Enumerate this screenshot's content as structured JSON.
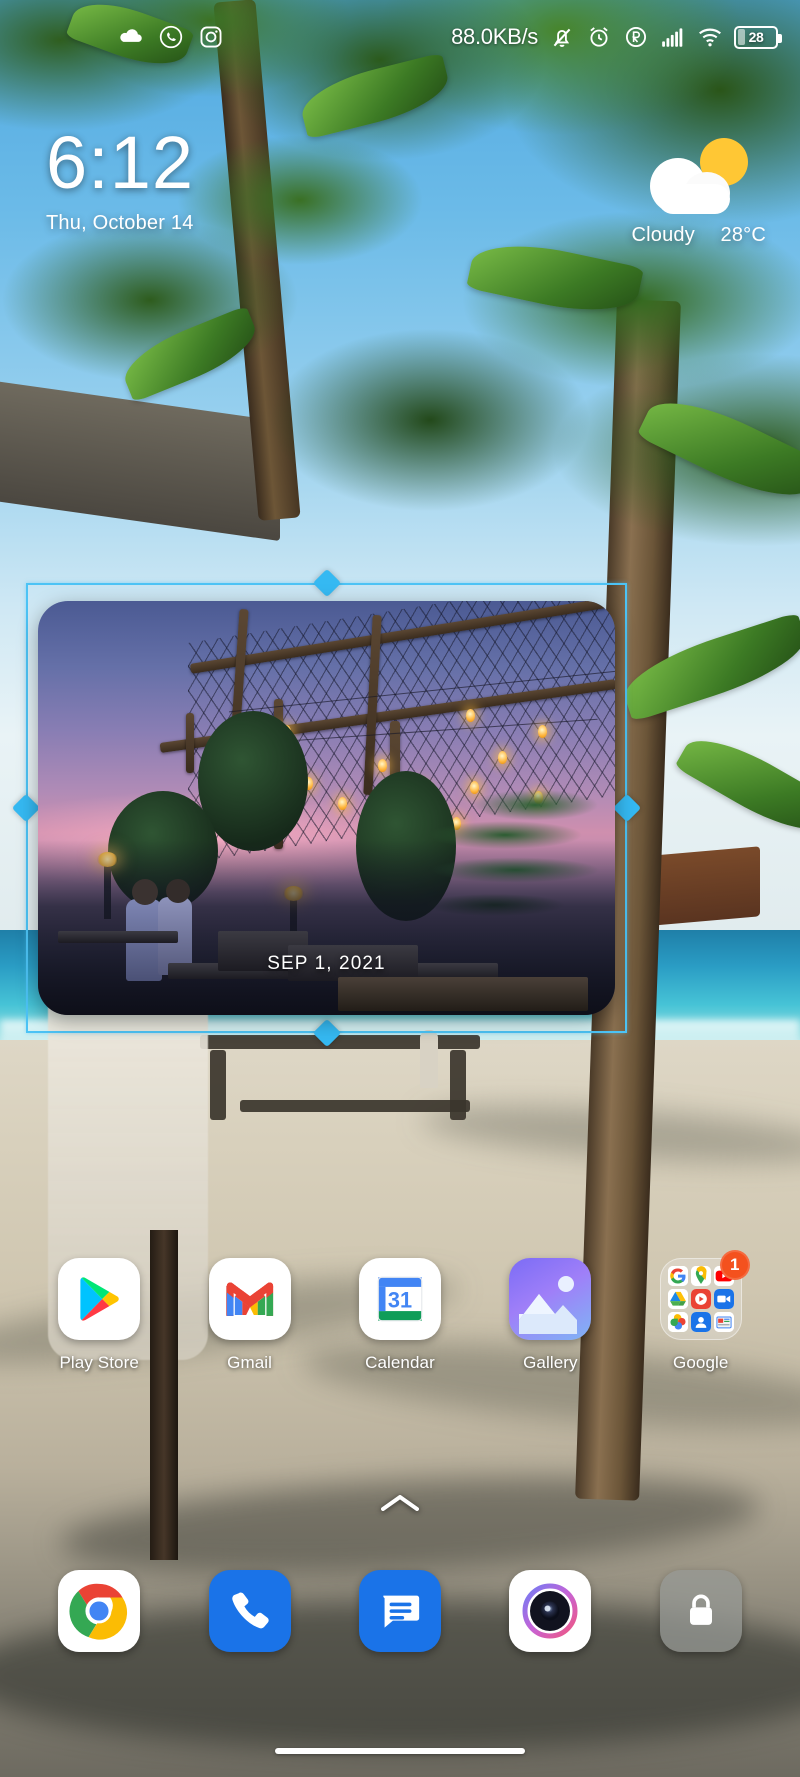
{
  "status_bar": {
    "network_speed": "88.0KB/s",
    "battery_percent": "28",
    "left_icons": [
      {
        "name": "cloud-sync-icon",
        "label": "Cloud"
      },
      {
        "name": "whatsapp-icon",
        "label": "WhatsApp"
      },
      {
        "name": "instagram-icon",
        "label": "Instagram"
      }
    ],
    "right_icons": [
      {
        "name": "mute-vibrate-icon",
        "label": "Silent"
      },
      {
        "name": "alarm-icon",
        "label": "Alarm"
      },
      {
        "name": "registered-r-icon",
        "label": "Roaming"
      },
      {
        "name": "signal-bars-icon",
        "label": "Signal"
      },
      {
        "name": "wifi-icon",
        "label": "Wi-Fi"
      }
    ]
  },
  "clock_widget": {
    "time": "6:12",
    "date": "Thu, October 14"
  },
  "weather_widget": {
    "condition": "Cloudy",
    "temperature": "28°C",
    "icon": "partly-cloudy-icon"
  },
  "photo_widget": {
    "date_caption": "SEP 1, 2021",
    "selected": true,
    "selection_color": "#35b9f2",
    "handles": [
      "top",
      "right",
      "bottom",
      "left"
    ]
  },
  "app_grid": [
    {
      "label": "Play Store",
      "icon": "play-store-icon"
    },
    {
      "label": "Gmail",
      "icon": "gmail-icon"
    },
    {
      "label": "Calendar",
      "icon": "calendar-icon",
      "day_number": "31"
    },
    {
      "label": "Gallery",
      "icon": "gallery-icon"
    },
    {
      "label": "Google",
      "icon": "google-folder-icon",
      "badge": "1",
      "folder_apps": [
        "google-search-icon",
        "google-maps-icon",
        "youtube-icon",
        "google-drive-icon",
        "google-play-movies-icon",
        "google-meet-icon",
        "google-photos-icon",
        "google-contacts-icon",
        "google-news-icon"
      ]
    }
  ],
  "page_indicator": {
    "icon": "chevron-up-icon"
  },
  "dock": [
    {
      "label": "Chrome",
      "icon": "chrome-icon"
    },
    {
      "label": "Phone",
      "icon": "phone-icon"
    },
    {
      "label": "Messages",
      "icon": "messages-icon"
    },
    {
      "label": "Camera",
      "icon": "camera-icon"
    },
    {
      "label": "Lock",
      "icon": "lock-icon"
    }
  ],
  "navigation_bar": {
    "type": "gesture-pill"
  }
}
